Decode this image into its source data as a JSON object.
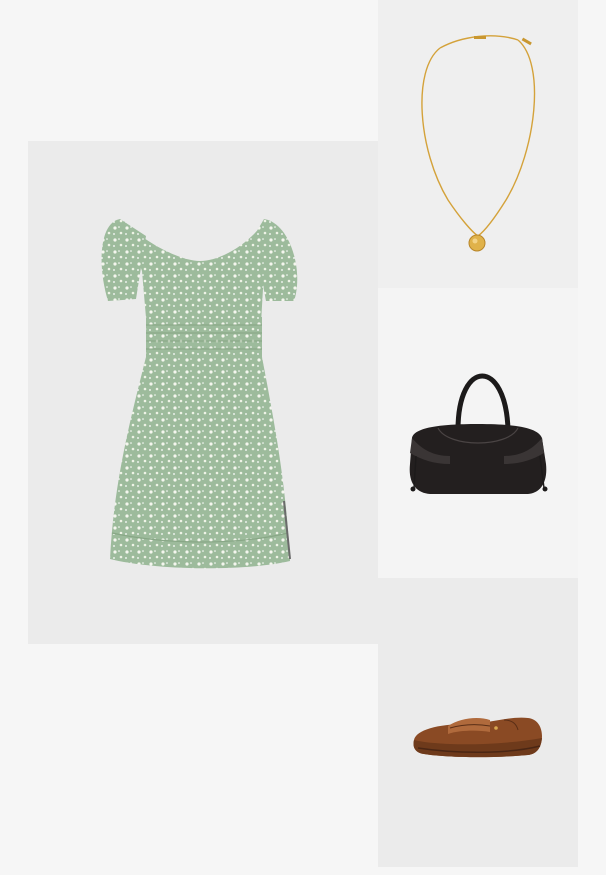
{
  "products": [
    {
      "id": "dress",
      "icon": "floral-mini-dress-image",
      "color": "#9dbb9c",
      "accent": "#ffffff"
    },
    {
      "id": "necklace",
      "icon": "gold-pendant-necklace-image",
      "color": "#d9a73a"
    },
    {
      "id": "bag",
      "icon": "black-leather-tote-bag-image",
      "color": "#1c1a1a"
    },
    {
      "id": "shoe",
      "icon": "brown-leather-loafer-image",
      "color": "#8a4a24"
    }
  ],
  "bag_logo_text": " "
}
